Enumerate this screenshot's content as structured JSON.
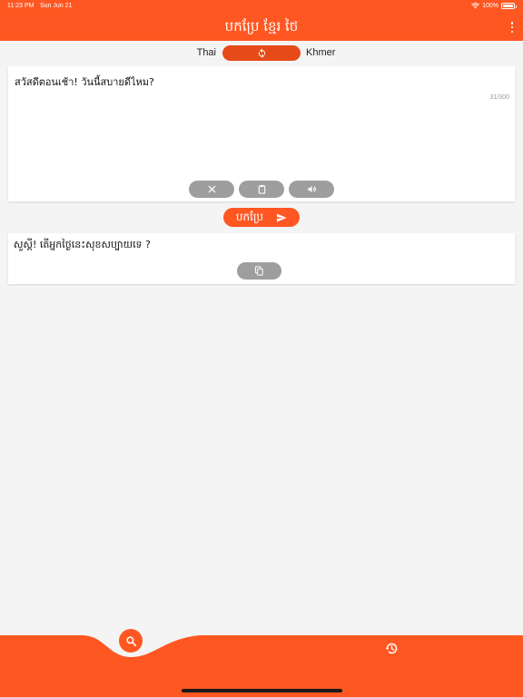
{
  "status_bar": {
    "time": "11:23 PM",
    "date": "Sun Jun 21",
    "battery": "100%"
  },
  "header": {
    "title": "បកប្រែ ខ្មែរ ថៃ",
    "menu_icon": "more-vertical-icon"
  },
  "languages": {
    "source": "Thai",
    "target": "Khmer",
    "swap_icon": "swap-refresh-icon"
  },
  "input": {
    "text": "สวัสดีตอนเช้า! วันนี้สบายดีไหม?",
    "char_count": "31/300",
    "actions": [
      {
        "icon": "clear-icon"
      },
      {
        "icon": "paste-icon"
      },
      {
        "icon": "speaker-icon"
      }
    ]
  },
  "translate": {
    "label": "បកប្រែ",
    "icon": "send-icon"
  },
  "output": {
    "text": "សួស្តី! តើអ្នកថ្ងៃនេះសុខសប្បាយទេ ?",
    "copy_icon": "copy-icon"
  },
  "bottom_nav": {
    "items": [
      {
        "icon": "search-icon",
        "active": true
      },
      {
        "icon": "history-icon",
        "active": false
      }
    ]
  },
  "colors": {
    "primary": "#ff5722",
    "primary_dark": "#e64a19",
    "button_gray": "#9e9e9e",
    "background": "#f4f4f4"
  }
}
